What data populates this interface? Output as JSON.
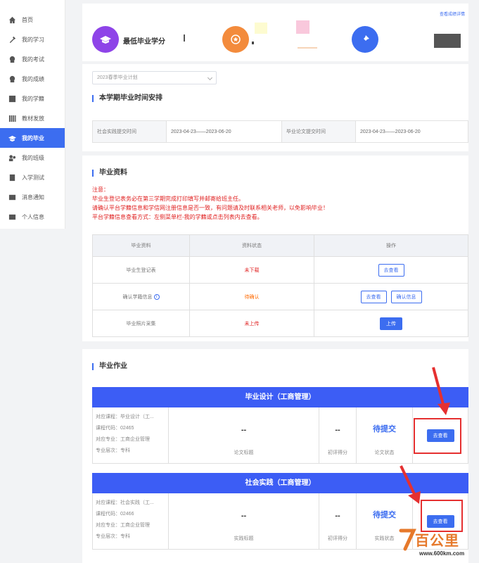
{
  "sidebar": {
    "items": [
      {
        "label": "首页",
        "icon": "home-icon"
      },
      {
        "label": "我的学习",
        "icon": "tools-icon"
      },
      {
        "label": "我的考试",
        "icon": "exam-icon"
      },
      {
        "label": "我的成绩",
        "icon": "score-icon"
      },
      {
        "label": "我的学籍",
        "icon": "record-icon"
      },
      {
        "label": "教材发放",
        "icon": "books-icon"
      },
      {
        "label": "我的毕业",
        "icon": "graduation-cap-icon",
        "active": true
      },
      {
        "label": "我的班级",
        "icon": "class-icon"
      },
      {
        "label": "入学测试",
        "icon": "test-icon"
      },
      {
        "label": "消息通知",
        "icon": "mail-icon"
      },
      {
        "label": "个人信息",
        "icon": "user-mail-icon"
      }
    ]
  },
  "summary": {
    "view_link": "查看成绩详情",
    "min_credit_label": "最低毕业学分"
  },
  "plan": {
    "select_value": "2023春季毕业计划",
    "schedule_title": "本学期毕业时间安排",
    "practice_label": "社会实践提交时间",
    "practice_range": "2023-04-23——2023-06-20",
    "thesis_label": "毕业论文提交时间",
    "thesis_range": "2023-04-23——2023-06-20"
  },
  "materials": {
    "title": "毕业资料",
    "notice": [
      "注意：",
      "毕业生登记表务必在第三学期完成打印填写并邮寄给班主任。",
      "请确认平台学籍信息和学信网注册信息是否一致，有问题请及时联系相关老师，以免影响毕业！",
      "平台学籍信息查看方式：左侧菜单栏-我的学籍或点击列表内去查看。"
    ],
    "headers": [
      "毕业资料",
      "资料状态",
      "操作"
    ],
    "rows": [
      {
        "name": "毕业生登记表",
        "status": "未下载",
        "action1": "去查看",
        "action2": ""
      },
      {
        "name": "确认学籍信息",
        "status": "待确认",
        "action1": "去查看",
        "action2": "确认信息"
      },
      {
        "name": "毕业照片采集",
        "status": "未上传",
        "action1": "上传",
        "action2": ""
      }
    ]
  },
  "homework": {
    "title": "毕业作业",
    "items": [
      {
        "heading": "毕业设计（工商管理）",
        "course": "对应课程：毕业设计（工...",
        "code": "课程代码：02465",
        "major": "对应专业：工商企业管理",
        "level": "专业层次：专科",
        "topic_value": "--",
        "topic_label": "论文标题",
        "score_value": "--",
        "score_label": "初评得分",
        "status_value": "待提交",
        "status_label": "论文状态",
        "button": "去查看"
      },
      {
        "heading": "社会实践（工商管理）",
        "course": "对应课程：社会实践（工...",
        "code": "课程代码：02466",
        "major": "对应专业：工商企业管理",
        "level": "专业层次：专科",
        "topic_value": "--",
        "topic_label": "实践标题",
        "score_value": "--",
        "score_label": "初评得分",
        "status_value": "待提交",
        "status_label": "实践状态",
        "button": "去查看"
      }
    ]
  },
  "watermark": {
    "brand": "百公里",
    "url": "www.600km.com"
  },
  "colors": {
    "accent": "#3c6df0",
    "alert": "#e02020",
    "annotation": "#e53030"
  }
}
